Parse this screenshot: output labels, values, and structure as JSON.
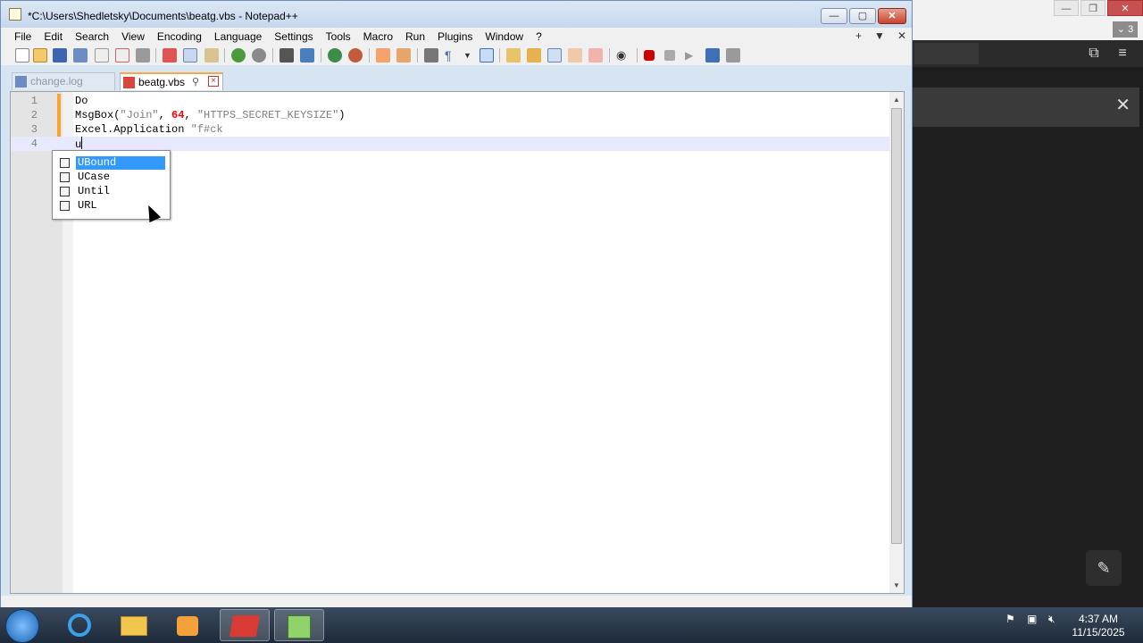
{
  "window": {
    "title": "*C:\\Users\\Shedletsky\\Documents\\beatg.vbs - Notepad++",
    "minimize": "—",
    "maximize": "▢",
    "close": "✕"
  },
  "menu": [
    "File",
    "Edit",
    "Search",
    "View",
    "Encoding",
    "Language",
    "Settings",
    "Tools",
    "Macro",
    "Run",
    "Plugins",
    "Window",
    "?"
  ],
  "menu_right": [
    "+",
    "▼",
    "✕"
  ],
  "tabs": [
    {
      "label": "change.log",
      "active": false
    },
    {
      "label": "beatg.vbs",
      "active": true
    }
  ],
  "editor": {
    "lines": [
      {
        "num": "1",
        "code": "Do"
      },
      {
        "num": "2",
        "code": "MsgBox(\"Join\", 64, \"HTTPS_SECRET_KEYSIZE\")"
      },
      {
        "num": "3",
        "code": "Excel.Application \"f#ck"
      },
      {
        "num": "4",
        "code": "u"
      }
    ]
  },
  "autocomplete": {
    "items": [
      "UBound",
      "UCase",
      "Until",
      "URL"
    ],
    "selected": "UBound"
  },
  "taskbar": {
    "clock_time": "4:37 AM",
    "clock_date": "11/15/2025"
  },
  "background_app": {
    "badge": "3"
  },
  "colors": {
    "keyword": "#0000ff",
    "string": "#808080",
    "number": "#ff0000",
    "selection": "#3399ff",
    "tab_accent": "#f6a84b"
  }
}
